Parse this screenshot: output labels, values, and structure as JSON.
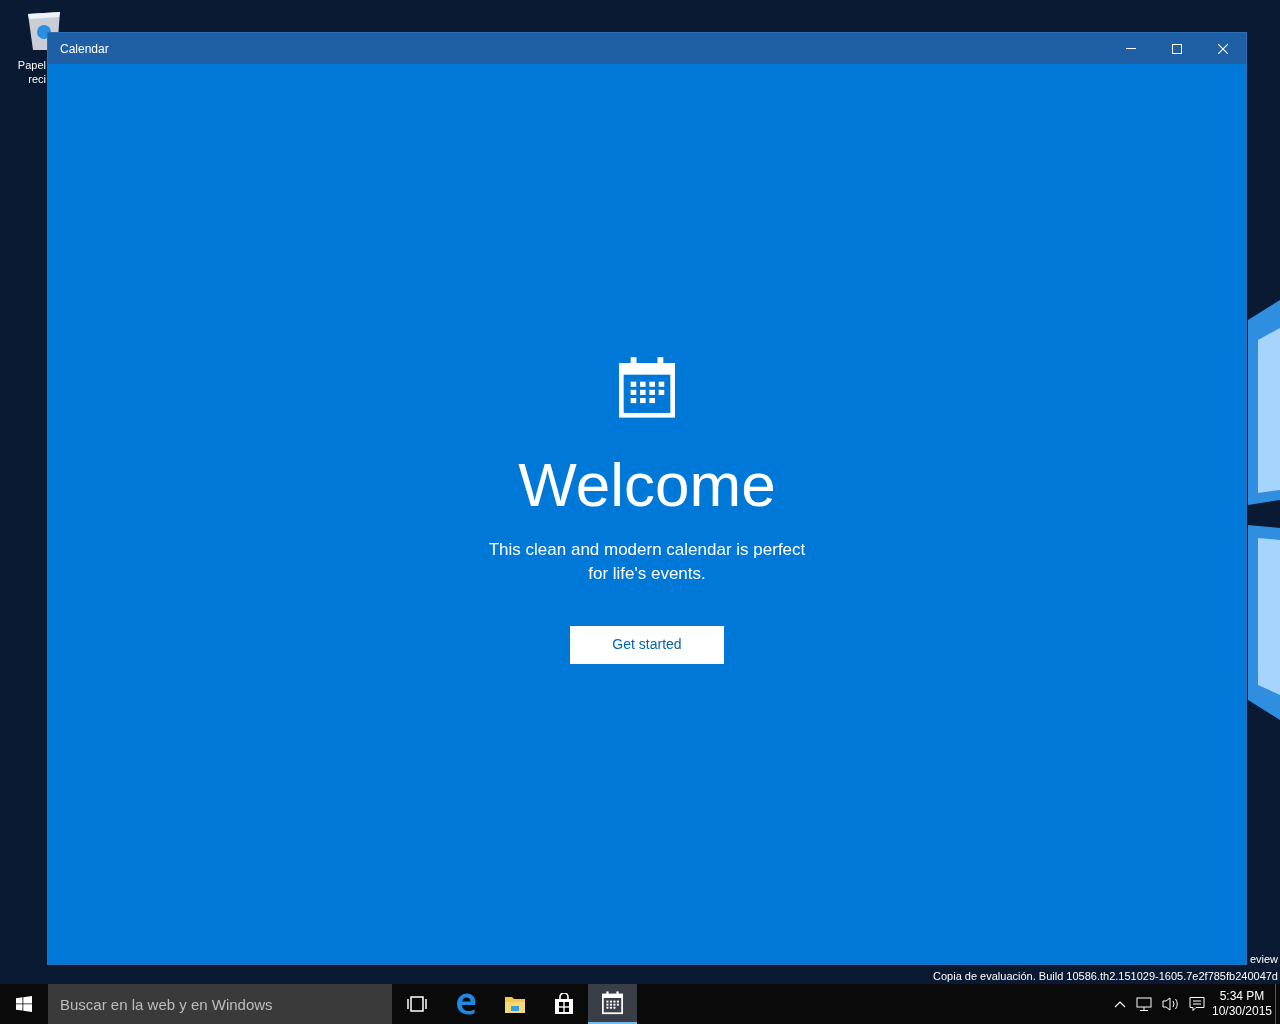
{
  "desktop": {
    "icons": [
      {
        "label_lines": [
          "Papel",
          "reci"
        ]
      }
    ],
    "edition_text": [
      "eview",
      "Copia de evaluación. Build 10586.th2.151029-1605.7e2f785fb240047d"
    ]
  },
  "window": {
    "title": "Calendar"
  },
  "welcome": {
    "heading": "Welcome",
    "text_lines": [
      "This clean and modern calendar is perfect",
      "for life's events."
    ],
    "button": "Get started"
  },
  "taskbar": {
    "search": {
      "placeholder": "Buscar en la web y en Windows"
    },
    "apps": [
      {
        "kind": "taskview",
        "selected": false
      },
      {
        "kind": "edge",
        "selected": false
      },
      {
        "kind": "explorer",
        "selected": false
      },
      {
        "kind": "store",
        "selected": false
      },
      {
        "kind": "calendar",
        "selected": true
      }
    ],
    "clock": {
      "time": "5:34 PM",
      "date": "10/30/2015"
    }
  }
}
